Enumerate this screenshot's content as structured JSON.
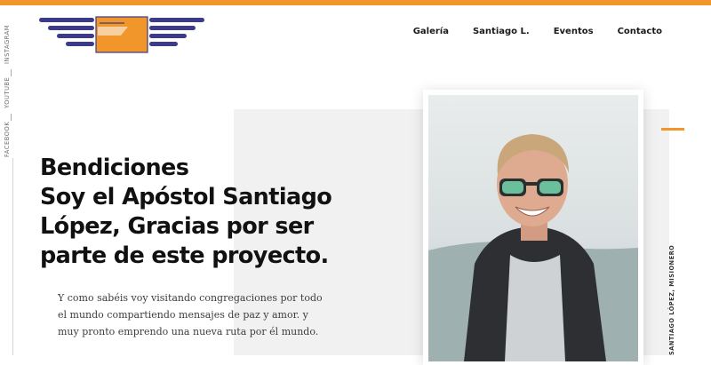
{
  "colors": {
    "accent": "#f0962b",
    "brand_navy": "#3c3a8a",
    "panel": "#f1f1f1"
  },
  "logo": {
    "icon": "winged-logo-icon"
  },
  "nav": {
    "items": [
      {
        "label": "Galería"
      },
      {
        "label": "Santiago L."
      },
      {
        "label": "Eventos"
      },
      {
        "label": "Contacto"
      }
    ]
  },
  "social": {
    "links": [
      {
        "label": "INSTAGRAM"
      },
      {
        "label": "YOUTUBE"
      },
      {
        "label": "FACEBOOK"
      }
    ]
  },
  "hero": {
    "headline_lines": [
      "Bendiciones",
      "Soy el Apóstol Santiago",
      "López, Gracias por ser",
      "parte de este proyecto."
    ],
    "body_lines": [
      "Y como sabéis voy visitando congregaciones por todo",
      "el mundo compartiendo mensajes de paz y amor. y",
      "muy pronto emprendo una nueva ruta por él mundo."
    ],
    "photo_caption": "SANTIAGO LÓPEZ, MISIONERO"
  }
}
